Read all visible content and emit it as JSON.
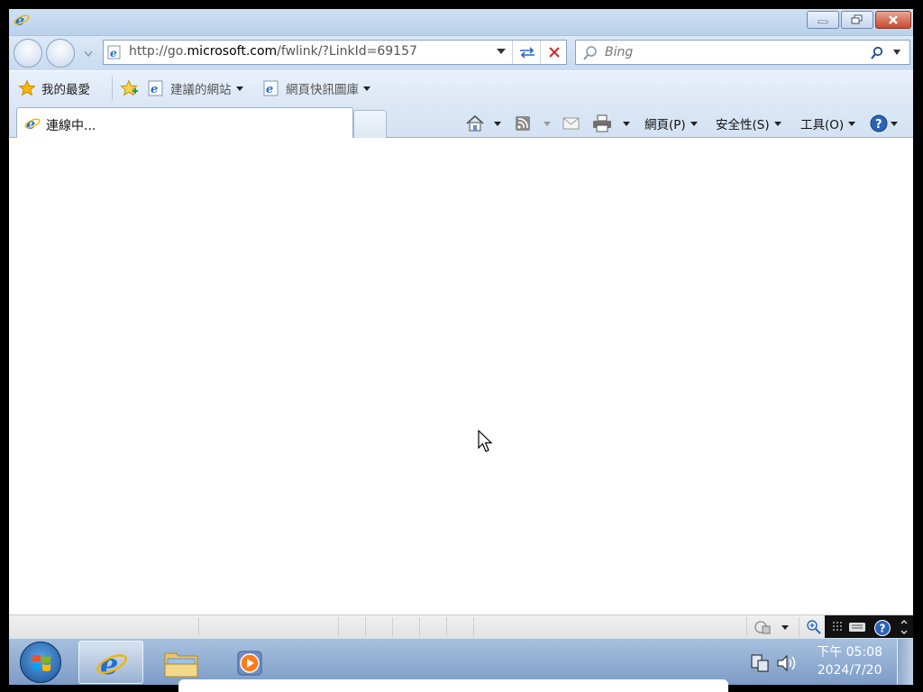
{
  "navigation": {
    "address": {
      "prefix": "http://go.",
      "domain": "microsoft.com",
      "suffix": "/fwlink/?LinkId=69157"
    },
    "search_placeholder": "Bing"
  },
  "favorites_bar": {
    "favorites": "我的最愛",
    "suggested_sites": "建議的網站",
    "web_slice_gallery": "網頁快訊圖庫"
  },
  "tab": {
    "title": "連線中..."
  },
  "command_bar": {
    "page": "網頁(P)",
    "safety": "安全性(S)",
    "tools": "工具(O)"
  },
  "taskbar": {
    "clock_time": "下午 05:08",
    "clock_date": "2024/7/20"
  },
  "colors": {
    "ie_blue": "#1e6fd0",
    "close_red": "#c7492f",
    "stop_red": "#d32f2f",
    "favorites_star": "#f5b400"
  }
}
